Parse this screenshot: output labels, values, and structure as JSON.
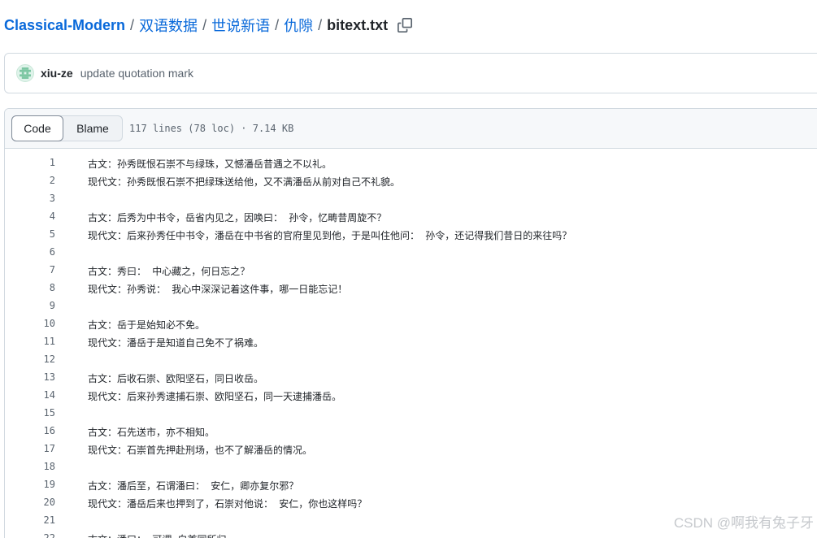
{
  "breadcrumb": {
    "root": "Classical-Modern",
    "separator": "/",
    "segments": [
      "双语数据",
      "世说新语",
      "仇隙"
    ],
    "file": "bitext.txt"
  },
  "commit": {
    "author": "xiu-ze",
    "message": "update quotation mark"
  },
  "file_header": {
    "tabs": [
      "Code",
      "Blame"
    ],
    "active_tab": "Code",
    "meta": "117 lines (78 loc) · 7.14 KB"
  },
  "code": {
    "lines": [
      {
        "n": "1",
        "text": "古文：孙秀既恨石崇不与绿珠，又憾潘岳昔遇之不以礼。"
      },
      {
        "n": "2",
        "text": "现代文：孙秀既恨石崇不把绿珠送给他，又不满潘岳从前对自己不礼貌。"
      },
      {
        "n": "3",
        "text": ""
      },
      {
        "n": "4",
        "text": "古文：后秀为中书令，岳省内见之，因唤曰： 孙令，忆畴昔周旋不？"
      },
      {
        "n": "5",
        "text": "现代文：后来孙秀任中书令，潘岳在中书省的官府里见到他，于是叫住他问： 孙令，还记得我们昔日的来往吗？"
      },
      {
        "n": "6",
        "text": ""
      },
      {
        "n": "7",
        "text": "古文：秀曰： 中心藏之，何日忘之？"
      },
      {
        "n": "8",
        "text": "现代文：孙秀说： 我心中深深记着这件事，哪一日能忘记！"
      },
      {
        "n": "9",
        "text": ""
      },
      {
        "n": "10",
        "text": "古文：岳于是始知必不免。"
      },
      {
        "n": "11",
        "text": "现代文：潘岳于是知道自己免不了祸难。"
      },
      {
        "n": "12",
        "text": ""
      },
      {
        "n": "13",
        "text": "古文：后收石崇、欧阳坚石，同日收岳。"
      },
      {
        "n": "14",
        "text": "现代文：后来孙秀逮捕石崇、欧阳坚石，同一天逮捕潘岳。"
      },
      {
        "n": "15",
        "text": ""
      },
      {
        "n": "16",
        "text": "古文：石先送市，亦不相知。"
      },
      {
        "n": "17",
        "text": "现代文：石崇首先押赴刑场，也不了解潘岳的情况。"
      },
      {
        "n": "18",
        "text": ""
      },
      {
        "n": "19",
        "text": "古文：潘后至，石谓潘曰： 安仁，卿亦复尔邪？"
      },
      {
        "n": "20",
        "text": "现代文：潘岳后来也押到了，石崇对他说： 安仁，你也这样吗？"
      },
      {
        "n": "21",
        "text": ""
      },
      {
        "n": "22",
        "text": "古文：潘曰： 可谓 白首同所归"
      }
    ]
  },
  "watermark": "CSDN @啊我有兔子牙"
}
